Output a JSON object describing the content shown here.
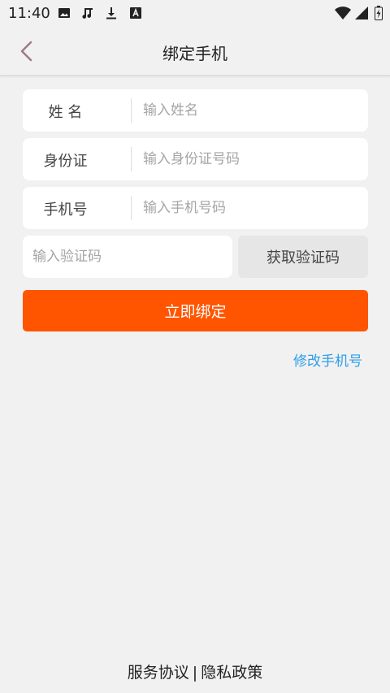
{
  "status_bar": {
    "time": "11:40",
    "left_icons": [
      "image-icon",
      "music-note-icon",
      "download-icon",
      "font-a-icon"
    ],
    "right_icons": [
      "wifi-icon",
      "signal-icon",
      "battery-icon"
    ]
  },
  "nav": {
    "title": "绑定手机",
    "back_icon": "chevron-left-icon"
  },
  "form": {
    "name": {
      "label": "姓 名",
      "placeholder": "输入姓名",
      "value": ""
    },
    "id_card": {
      "label": "身份证",
      "placeholder": "输入身份证号码",
      "value": ""
    },
    "phone": {
      "label": "手机号",
      "placeholder": "输入手机号码",
      "value": ""
    },
    "code": {
      "placeholder": "输入验证码",
      "value": "",
      "button_label": "获取验证码"
    }
  },
  "actions": {
    "bind_label": "立即绑定",
    "change_phone_label": "修改手机号"
  },
  "footer": {
    "service_agreement": "服务协议",
    "separator": "|",
    "privacy_policy": "隐私政策"
  },
  "colors": {
    "primary": "#ff5500",
    "link": "#2e9ee8",
    "background": "#f1f1f1"
  }
}
